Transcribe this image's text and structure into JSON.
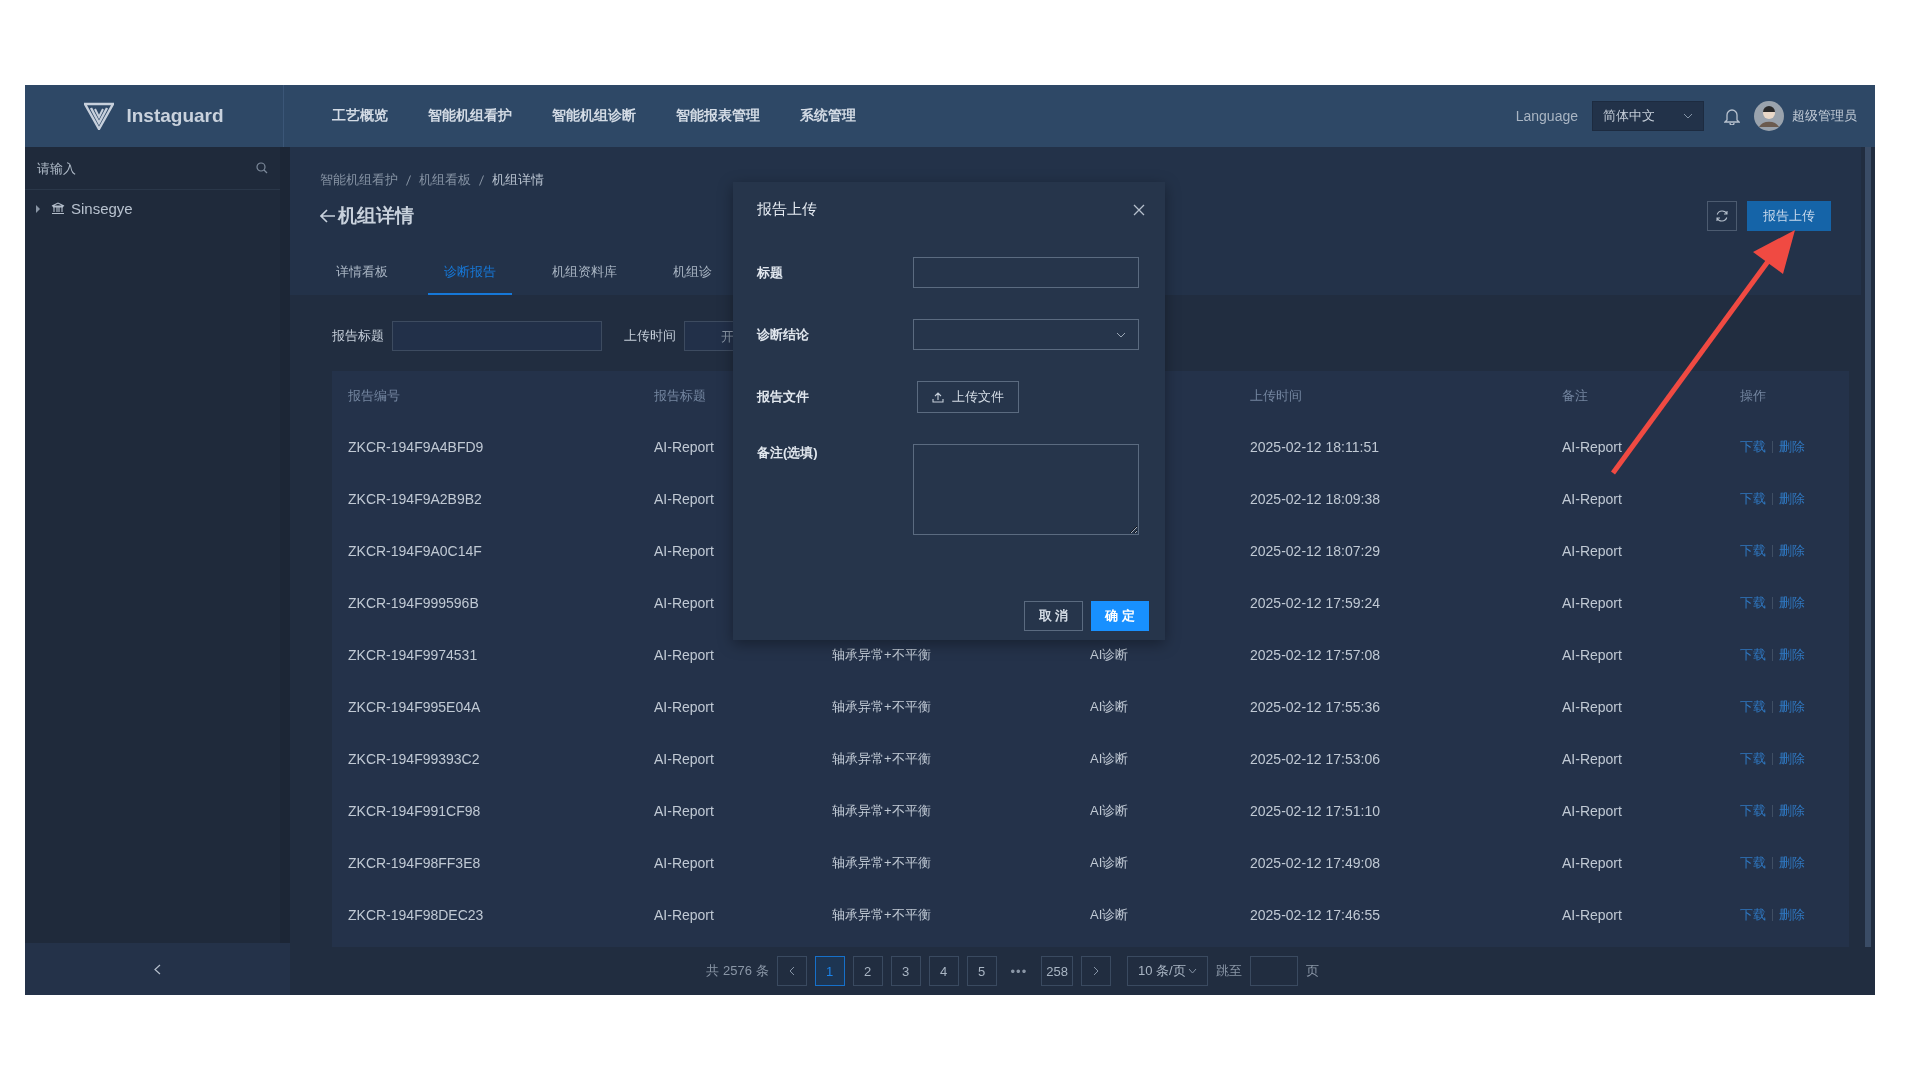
{
  "header": {
    "logo": "Instaguard",
    "nav": [
      {
        "label": "工艺概览",
        "selected": false
      },
      {
        "label": "智能机组看护",
        "selected": false
      },
      {
        "label": "智能机组诊断",
        "selected": false
      },
      {
        "label": "智能报表管理",
        "selected": false
      },
      {
        "label": "系统管理",
        "selected": false
      }
    ],
    "language_label": "Language",
    "language": "简体中文",
    "user": "超级管理员"
  },
  "sidebar": {
    "search_placeholder": "请输入",
    "tree": [
      {
        "label": "Sinsegye",
        "expanded": false
      }
    ]
  },
  "breadcrumb": [
    "智能机组看护",
    "机组看板",
    "机组详情"
  ],
  "page_title": "机组详情",
  "upload_button": "报告上传",
  "tabs": [
    {
      "label": "详情看板",
      "selected": false
    },
    {
      "label": "诊断报告",
      "selected": true
    },
    {
      "label": "机组资料库",
      "selected": false
    },
    {
      "label": "机组诊",
      "selected": false
    }
  ],
  "filters": {
    "title_label": "报告标题",
    "time_label": "上传时间",
    "time_placeholder": "开"
  },
  "table": {
    "columns": [
      "报告编号",
      "报告标题",
      null,
      null,
      "上传时间",
      "备注",
      "操作"
    ],
    "rows": [
      {
        "id": "ZKCR-194F9A4BFD9",
        "title": "AI-Report",
        "time": "2025-02-12 18:11:51",
        "note": "AI-Report",
        "actions": [
          "下载",
          "删除"
        ]
      },
      {
        "id": "ZKCR-194F9A2B9B2",
        "title": "AI-Report",
        "time": "2025-02-12 18:09:38",
        "note": "AI-Report",
        "actions": [
          "下载",
          "删除"
        ]
      },
      {
        "id": "ZKCR-194F9A0C14F",
        "title": "AI-Report",
        "time": "2025-02-12 18:07:29",
        "note": "AI-Report",
        "actions": [
          "下载",
          "删除"
        ]
      },
      {
        "id": "ZKCR-194F999596B",
        "title": "AI-Report",
        "time": "2025-02-12 17:59:24",
        "note": "AI-Report",
        "actions": [
          "下载",
          "删除"
        ]
      },
      {
        "id": "ZKCR-194F9974531",
        "title": "AI-Report",
        "column_3": "轴承异常+不平衡",
        "column_4": "AI诊断",
        "time": "2025-02-12 17:57:08",
        "note": "AI-Report",
        "actions": [
          "下载",
          "删除"
        ]
      },
      {
        "id": "ZKCR-194F995E04A",
        "title": "AI-Report",
        "column_3": "轴承异常+不平衡",
        "column_4": "AI诊断",
        "time": "2025-02-12 17:55:36",
        "note": "AI-Report",
        "actions": [
          "下载",
          "删除"
        ]
      },
      {
        "id": "ZKCR-194F99393C2",
        "title": "AI-Report",
        "column_3": "轴承异常+不平衡",
        "column_4": "AI诊断",
        "time": "2025-02-12 17:53:06",
        "note": "AI-Report",
        "actions": [
          "下载",
          "删除"
        ]
      },
      {
        "id": "ZKCR-194F991CF98",
        "title": "AI-Report",
        "column_3": "轴承异常+不平衡",
        "column_4": "AI诊断",
        "time": "2025-02-12 17:51:10",
        "note": "AI-Report",
        "actions": [
          "下载",
          "删除"
        ]
      },
      {
        "id": "ZKCR-194F98FF3E8",
        "title": "AI-Report",
        "column_3": "轴承异常+不平衡",
        "column_4": "AI诊断",
        "time": "2025-02-12 17:49:08",
        "note": "AI-Report",
        "actions": [
          "下载",
          "删除"
        ]
      },
      {
        "id": "ZKCR-194F98DEC23",
        "title": "AI-Report",
        "column_3": "轴承异常+不平衡",
        "column_4": "AI诊断",
        "time": "2025-02-12 17:46:55",
        "note": "AI-Report",
        "actions": [
          "下载",
          "删除"
        ]
      }
    ]
  },
  "pagination": {
    "total": "共 2576 条",
    "pages": [
      {
        "label": "1",
        "selected": true
      },
      {
        "label": "2",
        "selected": false
      },
      {
        "label": "3",
        "selected": false
      },
      {
        "label": "4",
        "selected": false
      },
      {
        "label": "5",
        "selected": false
      },
      {
        "label": "•••",
        "kind": "ellipsis"
      },
      {
        "label": "258",
        "selected": false
      }
    ],
    "page_size": "10 条/页",
    "jump_label": "跳至",
    "page_unit": "页"
  },
  "dialog": {
    "title": "报告上传",
    "fields": [
      {
        "label": "标题",
        "kind": "input"
      },
      {
        "label": "诊断结论",
        "kind": "select"
      },
      {
        "label": "报告文件",
        "kind": "upload",
        "button": "上传文件"
      },
      {
        "label": "备注(选填)",
        "kind": "textarea"
      }
    ],
    "cancel": "取 消",
    "confirm": "确 定"
  }
}
